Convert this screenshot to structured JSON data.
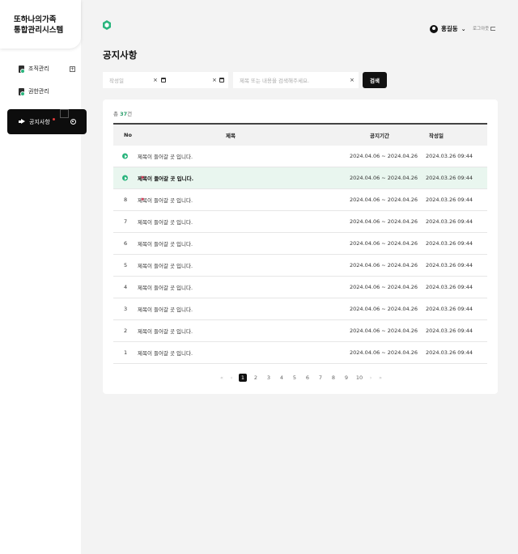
{
  "app": {
    "title_line1": "또하나의가족",
    "title_line2": "통합관리시스템"
  },
  "sidebar": {
    "items": [
      {
        "label": "조직관리",
        "icon": "document-icon"
      },
      {
        "label": "권한관리",
        "icon": "document-icon"
      },
      {
        "label": "공지사항",
        "icon": "megaphone-icon",
        "active": true
      }
    ]
  },
  "header": {
    "user_name": "홍길동",
    "logout_label": "로그아웃"
  },
  "page": {
    "title": "공지사항"
  },
  "filters": {
    "date_placeholder": "작성일",
    "date_separator": "-",
    "keyword_placeholder": "제목 또는 내용을 검색해주세요.",
    "search_label": "검색"
  },
  "list": {
    "total_prefix": "총",
    "total_count": "37",
    "total_suffix": "건",
    "columns": {
      "no": "No",
      "title": "제목",
      "period": "공지기간",
      "date": "작성일"
    },
    "rows": [
      {
        "no": "",
        "pinned": true,
        "title": "제목이 들어갈 곳 입니다.",
        "new": false,
        "bold": false,
        "highlight": false,
        "period": "2024.04.06 ~ 2024.04.26",
        "date": "2024.03.26 09:44"
      },
      {
        "no": "",
        "pinned": true,
        "title": "제목이 들어갈 곳 입니다.",
        "new": true,
        "bold": true,
        "highlight": true,
        "period": "2024.04.06 ~ 2024.04.26",
        "date": "2024.03.26 09:44"
      },
      {
        "no": "8",
        "pinned": false,
        "title": "제목이 들어갈 곳 입니다.",
        "new": true,
        "bold": false,
        "highlight": false,
        "period": "2024.04.06 ~ 2024.04.26",
        "date": "2024.03.26 09:44"
      },
      {
        "no": "7",
        "pinned": false,
        "title": "제목이 들어갈 곳 입니다.",
        "new": false,
        "bold": false,
        "highlight": false,
        "period": "2024.04.06 ~ 2024.04.26",
        "date": "2024.03.26 09:44"
      },
      {
        "no": "6",
        "pinned": false,
        "title": "제목이 들어갈 곳 입니다.",
        "new": false,
        "bold": false,
        "highlight": false,
        "period": "2024.04.06 ~ 2024.04.26",
        "date": "2024.03.26 09:44"
      },
      {
        "no": "5",
        "pinned": false,
        "title": "제목이 들어갈 곳 입니다.",
        "new": false,
        "bold": false,
        "highlight": false,
        "period": "2024.04.06 ~ 2024.04.26",
        "date": "2024.03.26 09:44"
      },
      {
        "no": "4",
        "pinned": false,
        "title": "제목이 들어갈 곳 입니다.",
        "new": false,
        "bold": false,
        "highlight": false,
        "period": "2024.04.06 ~ 2024.04.26",
        "date": "2024.03.26 09:44"
      },
      {
        "no": "3",
        "pinned": false,
        "title": "제목이 들어갈 곳 입니다.",
        "new": false,
        "bold": false,
        "highlight": false,
        "period": "2024.04.06 ~ 2024.04.26",
        "date": "2024.03.26 09:44"
      },
      {
        "no": "2",
        "pinned": false,
        "title": "제목이 들어갈 곳 입니다.",
        "new": false,
        "bold": false,
        "highlight": false,
        "period": "2024.04.06 ~ 2024.04.26",
        "date": "2024.03.26 09:44"
      },
      {
        "no": "1",
        "pinned": false,
        "title": "제목이 들어갈 곳 입니다.",
        "new": false,
        "bold": false,
        "highlight": false,
        "period": "2024.04.06 ~ 2024.04.26",
        "date": "2024.03.26 09:44"
      }
    ]
  },
  "pagination": {
    "first": "«",
    "prev": "‹",
    "next": "›",
    "last": "»",
    "pages": [
      "1",
      "2",
      "3",
      "4",
      "5",
      "6",
      "7",
      "8",
      "9",
      "10"
    ],
    "current": "1"
  },
  "colors": {
    "accent": "#2ab57d",
    "highlight_row": "#e9f6ef",
    "new_badge": "#d9304f"
  }
}
